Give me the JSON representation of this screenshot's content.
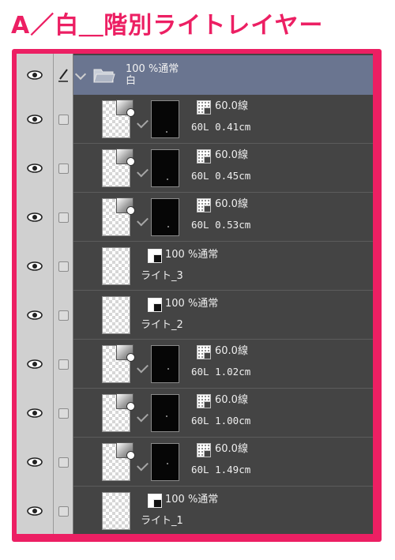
{
  "heading": "A／白＿階別ライトレイヤー",
  "colors": {
    "frame": "#ec1f63",
    "panel": "#444444",
    "folder_band": "#6a7590",
    "sidebar": "#d0d0d0"
  },
  "folder": {
    "blend": "100 %通常",
    "name": "白",
    "expanded": true,
    "icons": [
      "eye-icon",
      "pen-icon",
      "chevron-down-icon",
      "folder-open-icon"
    ]
  },
  "layers": [
    {
      "kind": "tone",
      "opacity_mode": "60.0線",
      "detail": "60L 0.41cm"
    },
    {
      "kind": "tone",
      "opacity_mode": "60.0線",
      "detail": "60L 0.45cm"
    },
    {
      "kind": "tone",
      "opacity_mode": "60.0線",
      "detail": "60L 0.53cm"
    },
    {
      "kind": "raster",
      "opacity_mode": "100 %通常",
      "detail": "ライト_3"
    },
    {
      "kind": "raster",
      "opacity_mode": "100 %通常",
      "detail": "ライト_2"
    },
    {
      "kind": "tone",
      "opacity_mode": "60.0線",
      "detail": "60L 1.02cm"
    },
    {
      "kind": "tone",
      "opacity_mode": "60.0線",
      "detail": "60L 1.00cm"
    },
    {
      "kind": "tone",
      "opacity_mode": "60.0線",
      "detail": "60L 1.49cm"
    },
    {
      "kind": "raster",
      "opacity_mode": "100 %通常",
      "detail": "ライト_1"
    }
  ]
}
